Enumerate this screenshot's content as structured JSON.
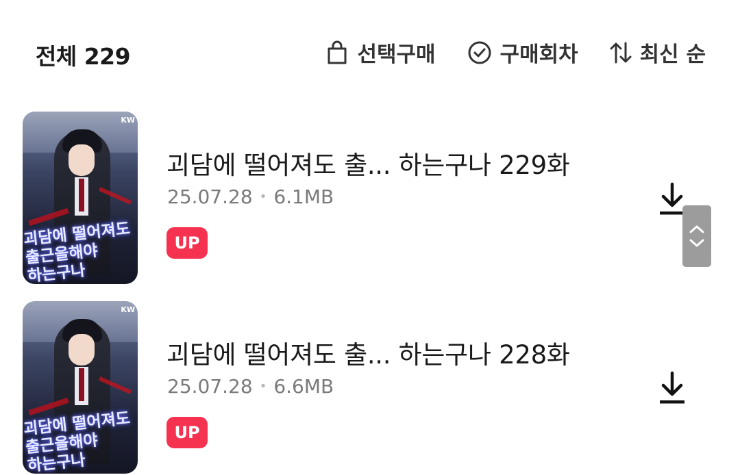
{
  "header": {
    "total_label": "전체 229",
    "actions": [
      {
        "label": "선택구매",
        "icon": "shopping-bag-icon"
      },
      {
        "label": "구매회차",
        "icon": "check-circle-icon"
      },
      {
        "label": "최신 순",
        "icon": "sort-arrows-icon"
      }
    ]
  },
  "episodes": [
    {
      "title": "괴담에 떨어져도 출... 하는구나 229화",
      "date": "25.07.28",
      "separator": "•",
      "size": "6.1MB",
      "badge": "UP",
      "cover": {
        "publisher": "KW",
        "title_line1": "괴담에 떨어져도",
        "title_line2": "출근을해야",
        "title_line3": "하는구나"
      }
    },
    {
      "title": "괴담에 떨어져도 출... 하는구나 228화",
      "date": "25.07.28",
      "separator": "•",
      "size": "6.6MB",
      "badge": "UP",
      "cover": {
        "publisher": "KW",
        "title_line1": "괴담에 떨어져도",
        "title_line2": "출근을해야",
        "title_line3": "하는구나"
      }
    }
  ],
  "colors": {
    "badge_bg": "#f5324f",
    "meta_text": "#7a7a7a",
    "scroll_handle": "#9c9c9c"
  }
}
